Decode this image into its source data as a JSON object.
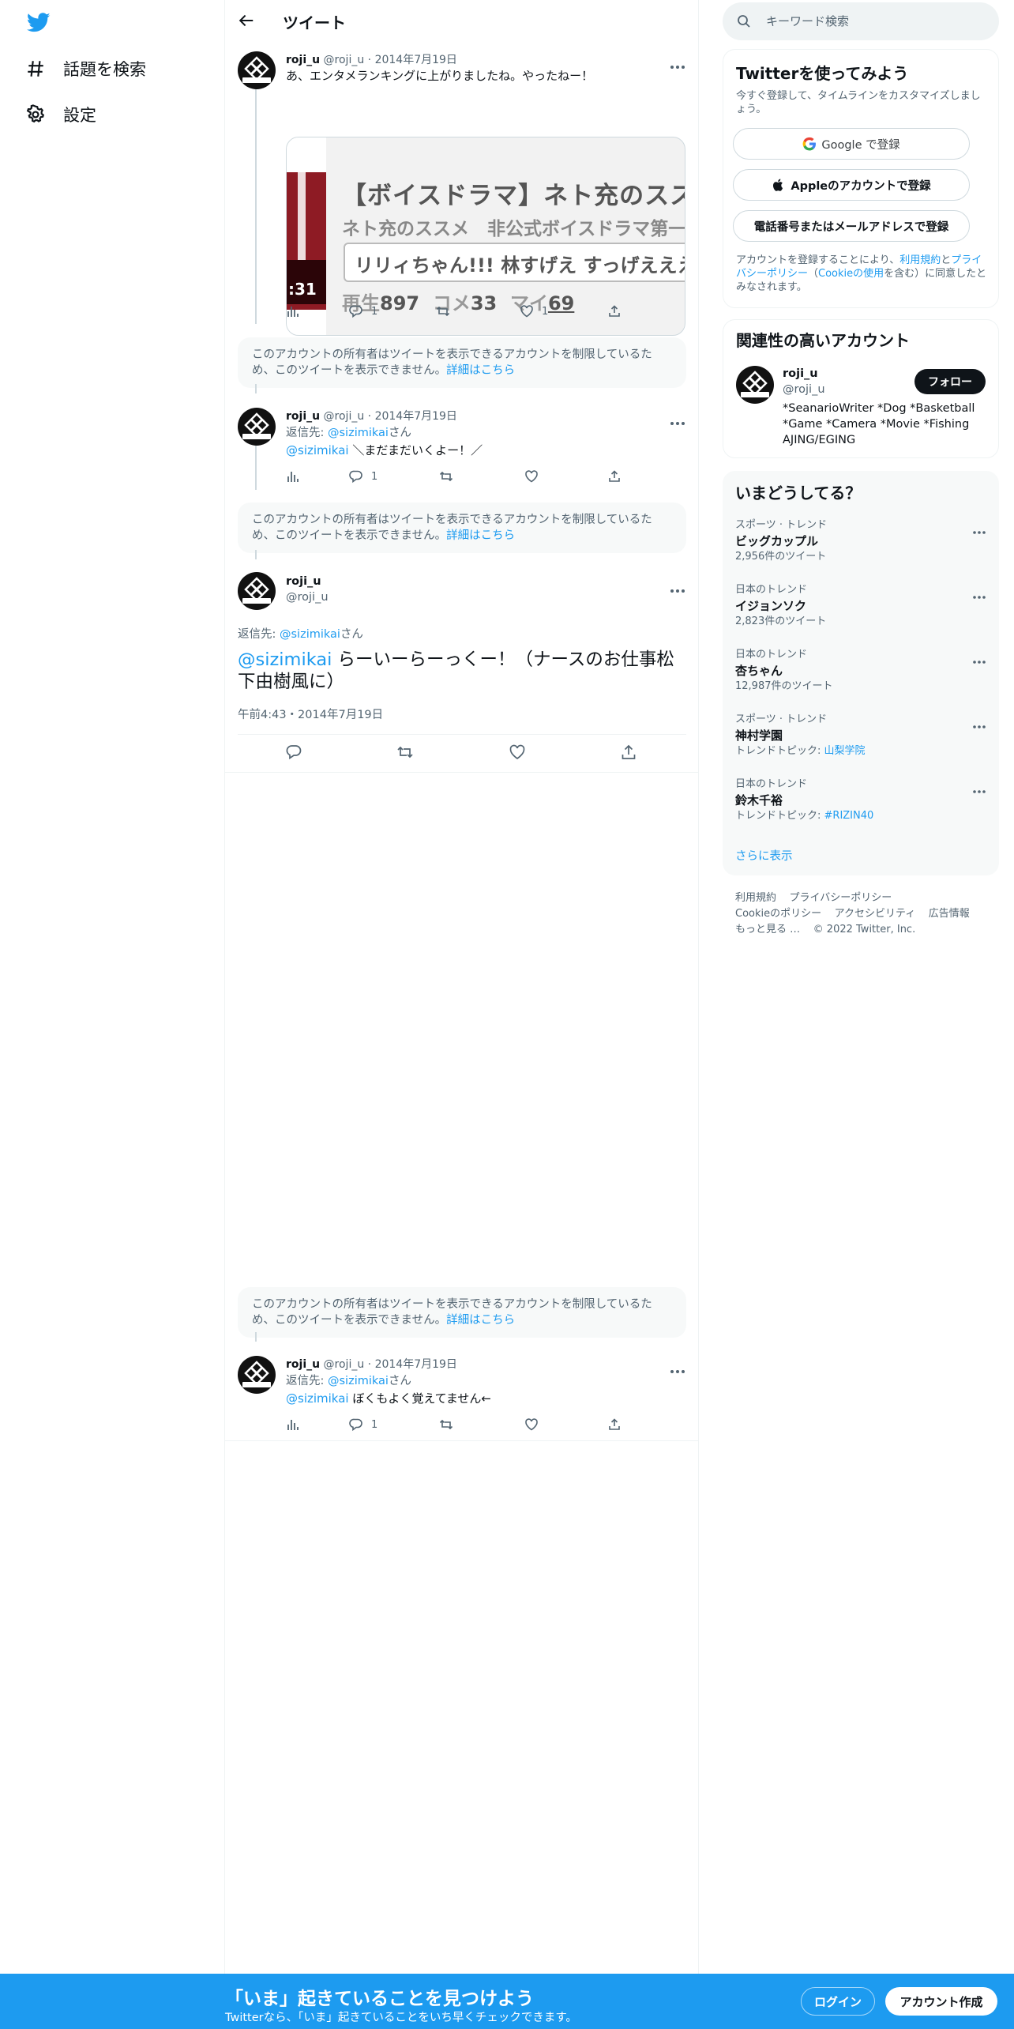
{
  "nav": {
    "logo_icon": "twitter-bird-icon",
    "items": [
      {
        "label": "話題を検索",
        "icon": "hashtag-icon"
      },
      {
        "label": "設定",
        "icon": "gear-icon"
      }
    ]
  },
  "header": {
    "title": "ツイート",
    "back_icon": "back-arrow-icon"
  },
  "tweets": {
    "t1": {
      "name": "roji_u",
      "meta": "@roji_u · 2014年7月19日",
      "text": "あ、エンタメランキングに上がりましたね。やったねー！",
      "card": {
        "title": "【ボイスドラマ】ネト充のススメ",
        "subtitle": "ネト充のススメ　非公式ボイスドラマ第一話",
        "comment": "リリィちゃん!!! 林すげえ すっげえええ!!屈",
        "duration": ":31",
        "stats_play_label": "再生",
        "stats_play": "897",
        "stats_comment_label": "コメ",
        "stats_comment": "33",
        "stats_mylist_label": "マイ",
        "stats_mylist": "69"
      },
      "reply_count": "1",
      "retweet_count": "",
      "like_count": "1"
    },
    "notice": {
      "text": "このアカウントの所有者はツイートを表示できるアカウントを制限しているため、このツイートを表示できません。",
      "link": "詳細はこちら"
    },
    "t2": {
      "name": "roji_u",
      "meta": "@roji_u · 2014年7月19日",
      "reply_prefix": "返信先: ",
      "reply_to": "@sizimikai",
      "reply_suffix": "さん",
      "mention": "@sizimikai",
      "text": " ＼まだまだいくよー！／",
      "reply_count": "1"
    },
    "focal": {
      "name": "roji_u",
      "handle": "@roji_u",
      "reply_prefix": "返信先: ",
      "reply_to": "@sizimikai",
      "reply_suffix": "さん",
      "mention": "@sizimikai",
      "text": " らーいーらーっくー！（ナースのお仕事松下由樹風に）",
      "time": "午前4:43・2014年7月19日"
    },
    "t3": {
      "name": "roji_u",
      "meta": "@roji_u · 2014年7月19日",
      "reply_prefix": "返信先: ",
      "reply_to": "@sizimikai",
      "reply_suffix": "さん",
      "mention": "@sizimikai",
      "text": " ぼくもよく覚えてません←",
      "reply_count": "1"
    }
  },
  "search": {
    "placeholder": "キーワード検索"
  },
  "signup_panel": {
    "title": "Twitterを使ってみよう",
    "subtitle": "今すぐ登録して、タイムラインをカスタマイズしましょう。",
    "google": "Google で登録",
    "apple": "Appleのアカウントで登録",
    "phone": "電話番号またはメールアドレスで登録",
    "terms_pre": "アカウントを登録することにより、",
    "terms_link1": "利用規約",
    "terms_mid": "と",
    "terms_link2": "プライバシーポリシー",
    "terms_mid2": "（",
    "terms_link3": "Cookieの使用",
    "terms_post": "を含む）に同意したとみなされます。"
  },
  "related": {
    "title": "関連性の高いアカウント",
    "name": "roji_u",
    "handle": "@roji_u",
    "follow": "フォロー",
    "bio": "*SeanarioWriter *Dog *Basketball *Game *Camera *Movie *Fishing AJING/EGING"
  },
  "trends": {
    "title": "いまどうしてる？",
    "items": [
      {
        "context": "スポーツ · トレンド",
        "name": "ビッグカップル",
        "count": "2,956件のツイート"
      },
      {
        "context": "日本のトレンド",
        "name": "イジョンソク",
        "count": "2,823件のツイート"
      },
      {
        "context": "日本のトレンド",
        "name": "杏ちゃん",
        "count": "12,987件のツイート"
      },
      {
        "context": "スポーツ · トレンド",
        "name": "神村学園",
        "topic_label": "トレンドトピック: ",
        "topic": "山梨学院"
      },
      {
        "context": "日本のトレンド",
        "name": "鈴木千裕",
        "topic_label": "トレンドトピック: ",
        "topic": "#RIZIN40"
      }
    ],
    "show_more": "さらに表示"
  },
  "footer": {
    "links1": [
      "利用規約",
      "プライバシーポリシー"
    ],
    "links2": [
      "Cookieのポリシー",
      "アクセシビリティ",
      "広告情報"
    ],
    "more": "もっと見る …",
    "copyright": "© 2022 Twitter, Inc."
  },
  "bottom_bar": {
    "title": "「いま」起きていることを見つけよう",
    "subtitle": "Twitterなら、「いま」起きていることをいち早くチェックできます。",
    "login": "ログイン",
    "signup": "アカウント作成"
  },
  "colors": {
    "accent": "#1d9bf0",
    "text": "#0f1419",
    "muted": "#536471",
    "border": "#eff3f4"
  }
}
